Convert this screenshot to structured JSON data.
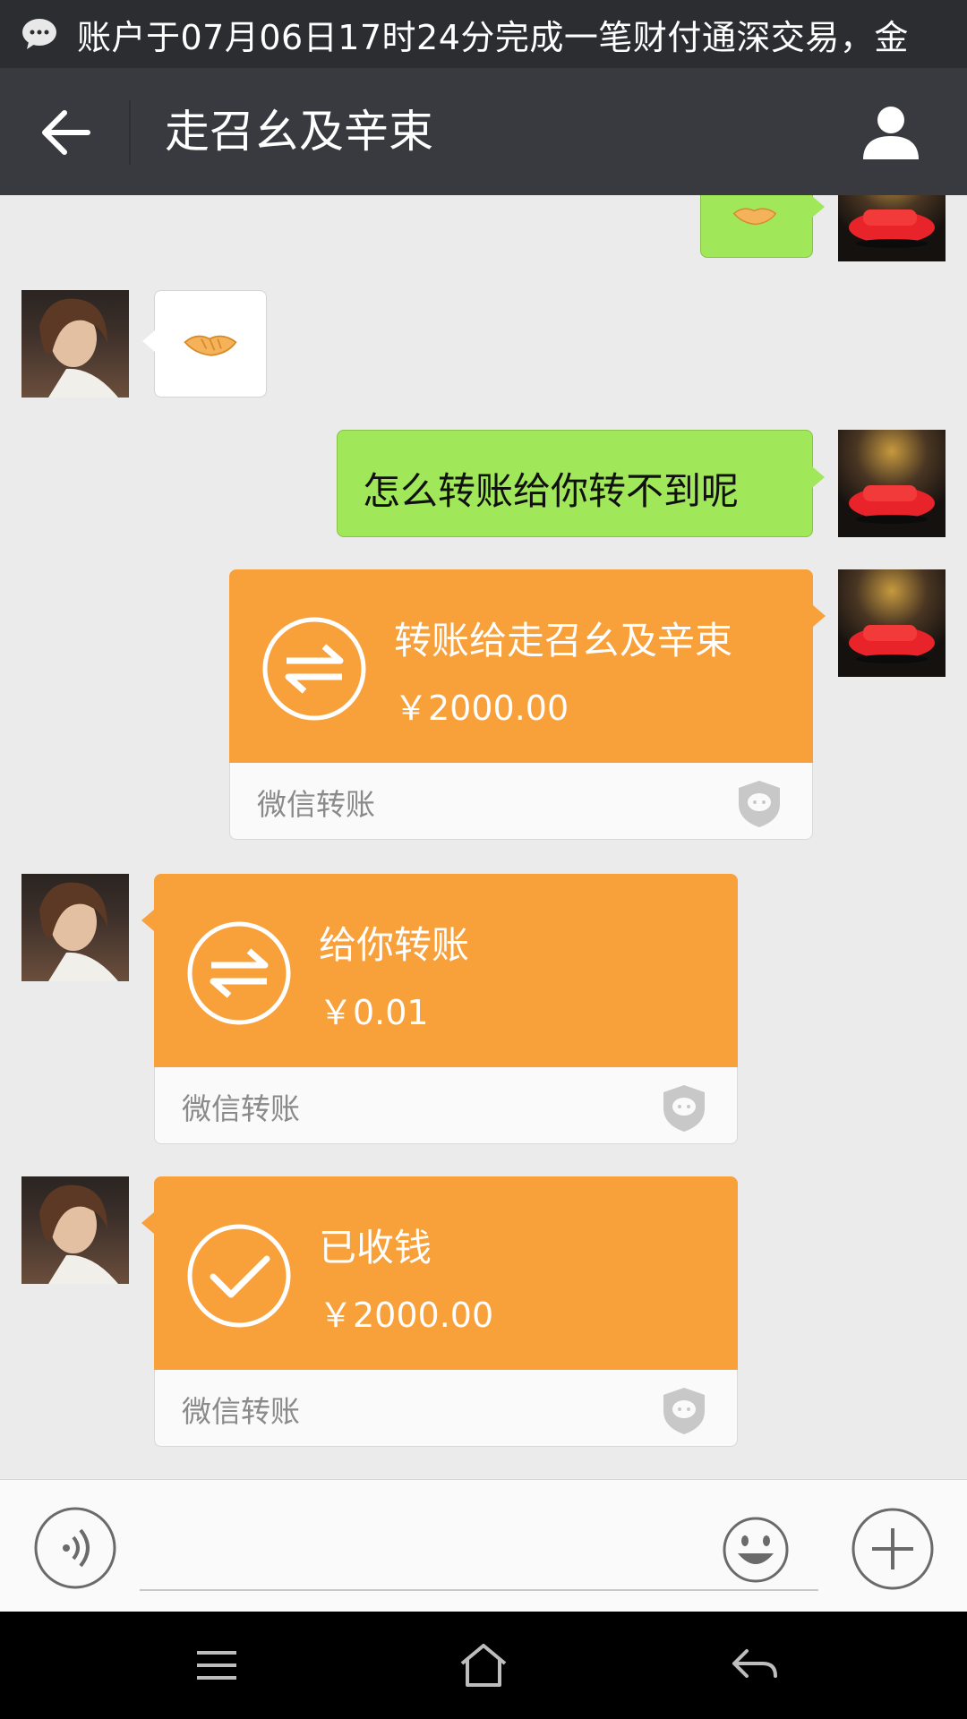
{
  "notification": {
    "icon": "chat-bubble-icon",
    "text": "账户于07月06日17时24分完成一笔财付通深交易，金"
  },
  "header": {
    "title": "走召幺及辛束",
    "back_icon": "back-arrow-icon",
    "profile_icon": "person-icon"
  },
  "messages": {
    "m1_partial_sticker": "handshake-emoji",
    "m2_sticker": "handshake-emoji",
    "m3_text": "怎么转账给你转不到呢",
    "m4": {
      "title": "转账给走召幺及辛束",
      "amount": "￥2000.00",
      "brand": "微信转账",
      "icon": "transfer-arrows-icon"
    },
    "m5": {
      "title": "给你转账",
      "amount": "￥0.01",
      "brand": "微信转账",
      "icon": "transfer-arrows-icon"
    },
    "m6": {
      "title": "已收钱",
      "amount": "￥2000.00",
      "brand": "微信转账",
      "icon": "checkmark-icon"
    }
  },
  "input_bar": {
    "voice_icon": "voice-icon",
    "emoji_icon": "smiley-icon",
    "plus_icon": "plus-icon",
    "value": ""
  },
  "system_nav": {
    "menu_icon": "menu-icon",
    "home_icon": "home-icon",
    "back_icon": "return-icon"
  },
  "colors": {
    "title_bar": "#393a3f",
    "status_bar": "#2b2d31",
    "chat_bg": "#ebebeb",
    "sent_bubble": "#a0e75a",
    "transfer_orange": "#f8a03a"
  }
}
